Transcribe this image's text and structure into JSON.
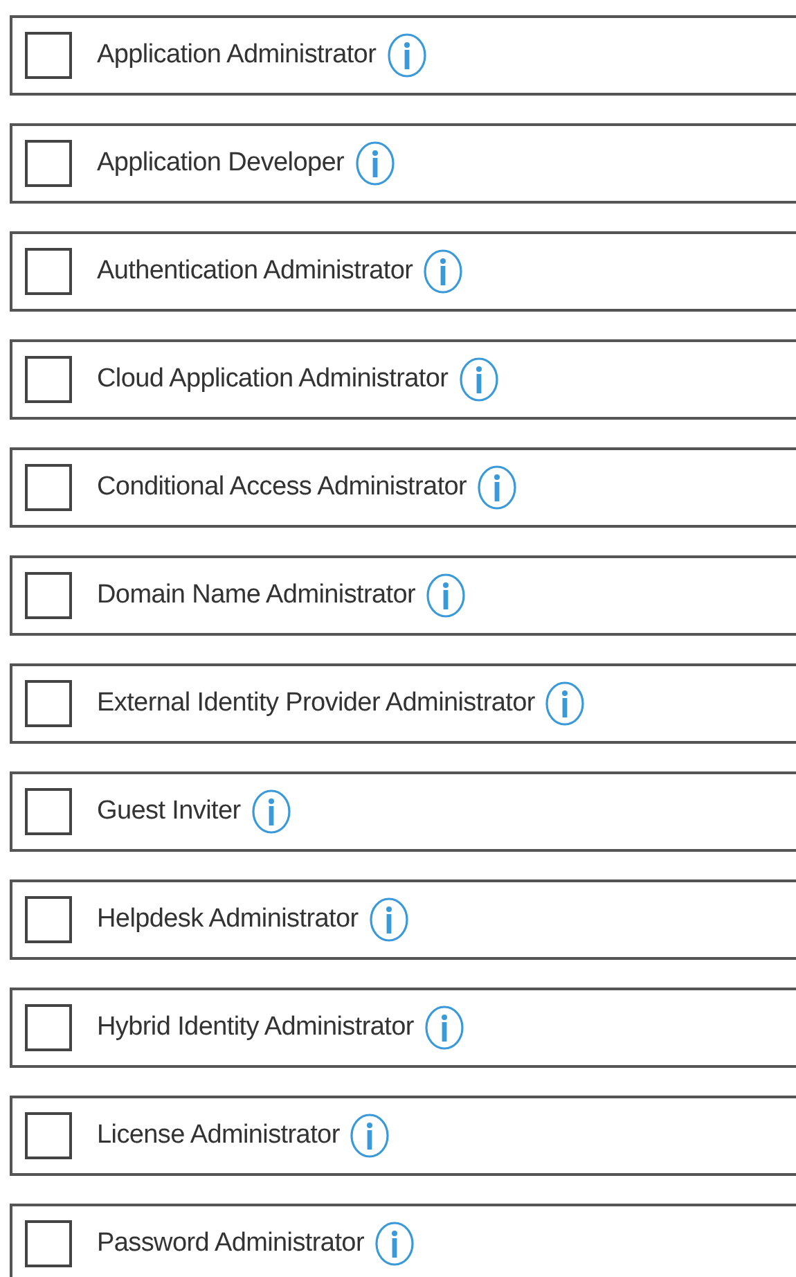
{
  "roles": [
    {
      "label": "Application Administrator",
      "checked": false
    },
    {
      "label": "Application Developer",
      "checked": false
    },
    {
      "label": "Authentication Administrator",
      "checked": false
    },
    {
      "label": "Cloud Application Administrator",
      "checked": false
    },
    {
      "label": "Conditional Access Administrator",
      "checked": false
    },
    {
      "label": "Domain Name Administrator",
      "checked": false
    },
    {
      "label": "External Identity Provider Administrator",
      "checked": false
    },
    {
      "label": "Guest Inviter",
      "checked": false
    },
    {
      "label": "Helpdesk Administrator",
      "checked": false
    },
    {
      "label": "Hybrid Identity Administrator",
      "checked": false
    },
    {
      "label": "License Administrator",
      "checked": false
    },
    {
      "label": "Password Administrator",
      "checked": false
    }
  ]
}
